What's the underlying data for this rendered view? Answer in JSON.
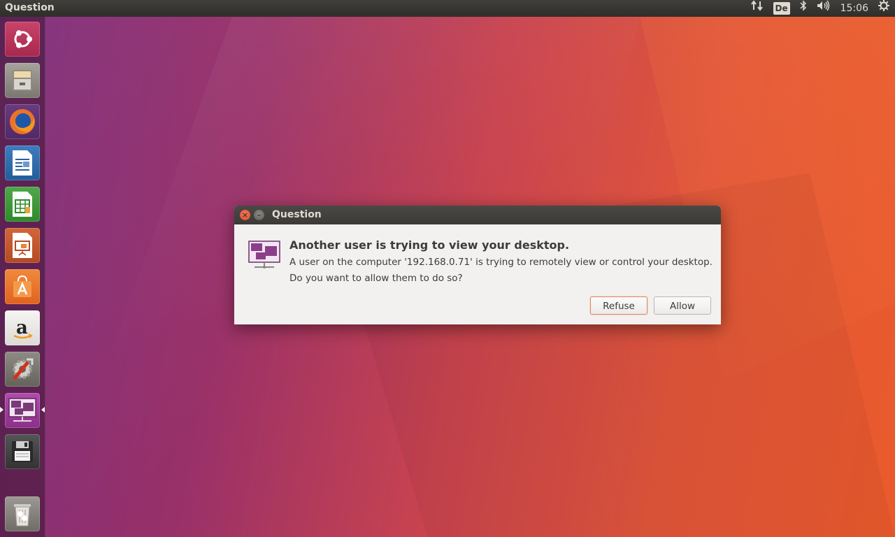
{
  "top_panel": {
    "title": "Question",
    "indicators": {
      "network_icon": "updown-arrows-icon",
      "keyboard_layout": "De",
      "bluetooth_icon": "bluetooth-icon",
      "volume_icon": "speaker-icon",
      "clock": "15:06",
      "settings_icon": "gear-icon"
    }
  },
  "launcher": {
    "items": [
      {
        "name": "Ubuntu Dash",
        "icon": "ubuntu-logo-icon"
      },
      {
        "name": "Files",
        "icon": "file-cabinet-icon"
      },
      {
        "name": "Firefox",
        "icon": "firefox-icon"
      },
      {
        "name": "LibreOffice Writer",
        "icon": "writer-document-icon"
      },
      {
        "name": "LibreOffice Calc",
        "icon": "calc-spreadsheet-icon"
      },
      {
        "name": "LibreOffice Impress",
        "icon": "impress-presentation-icon"
      },
      {
        "name": "Ubuntu Software",
        "icon": "software-bag-icon"
      },
      {
        "name": "Amazon",
        "icon": "amazon-icon"
      },
      {
        "name": "System Settings",
        "icon": "settings-tools-icon"
      },
      {
        "name": "Desktop Sharing",
        "icon": "desktop-sharing-icon",
        "active": true
      },
      {
        "name": "Save Disk",
        "icon": "floppy-disk-icon"
      },
      {
        "name": "Trash",
        "icon": "trash-icon"
      }
    ]
  },
  "dialog": {
    "title": "Question",
    "icon": "desktop-sharing-icon",
    "headline": "Another user is trying to view your desktop.",
    "body_line1": "A user on the computer '192.168.0.71' is trying to remotely view or control your desktop.",
    "body_line2": "Do you want to allow them to do so?",
    "refuse_label": "Refuse",
    "allow_label": "Allow"
  },
  "colors": {
    "accent": "#e95420",
    "panel": "#3c3b37",
    "dialog_bg": "#f2f1f0"
  }
}
